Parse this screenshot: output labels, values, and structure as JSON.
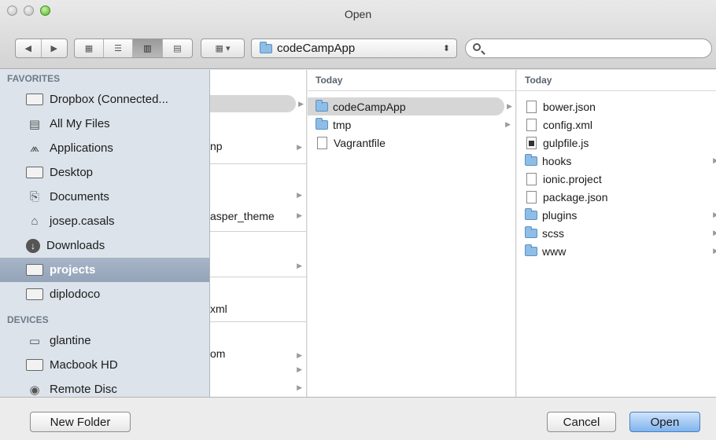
{
  "window": {
    "title": "Open"
  },
  "toolbar": {
    "view_icons": [
      "icon-view",
      "list-view",
      "column-view",
      "coverflow-view"
    ],
    "location": "codeCampApp",
    "search_placeholder": ""
  },
  "sidebar": {
    "favorites_header": "FAVORITES",
    "favorites": [
      {
        "label": "Dropbox (Connected...",
        "icon": "folder-icon"
      },
      {
        "label": "All My Files",
        "icon": "all-files-icon"
      },
      {
        "label": "Applications",
        "icon": "applications-icon"
      },
      {
        "label": "Desktop",
        "icon": "desktop-icon"
      },
      {
        "label": "Documents",
        "icon": "documents-icon"
      },
      {
        "label": "josep.casals",
        "icon": "home-icon"
      },
      {
        "label": "Downloads",
        "icon": "downloads-icon"
      },
      {
        "label": "projects",
        "icon": "folder-icon",
        "selected": true
      },
      {
        "label": "diplodoco",
        "icon": "folder-icon"
      }
    ],
    "devices_header": "DEVICES",
    "devices": [
      {
        "label": "glantine",
        "icon": "laptop-icon"
      },
      {
        "label": "Macbook HD",
        "icon": "disk-icon"
      },
      {
        "label": "Remote Disc",
        "icon": "remote-disc-icon"
      }
    ]
  },
  "column1": {
    "items": [
      "",
      "np",
      "asper_theme",
      "",
      "xml",
      "om",
      "",
      ""
    ]
  },
  "column2": {
    "header": "Today",
    "items": [
      {
        "label": "codeCampApp",
        "type": "folder",
        "selected": true,
        "has_children": true
      },
      {
        "label": "tmp",
        "type": "folder",
        "has_children": true
      },
      {
        "label": "Vagrantfile",
        "type": "file"
      }
    ]
  },
  "column3": {
    "header": "Today",
    "items": [
      {
        "label": "bower.json",
        "type": "file"
      },
      {
        "label": "config.xml",
        "type": "file"
      },
      {
        "label": "gulpfile.js",
        "type": "script"
      },
      {
        "label": "hooks",
        "type": "folder"
      },
      {
        "label": "ionic.project",
        "type": "file"
      },
      {
        "label": "package.json",
        "type": "file"
      },
      {
        "label": "plugins",
        "type": "folder"
      },
      {
        "label": "scss",
        "type": "folder"
      },
      {
        "label": "www",
        "type": "folder"
      }
    ]
  },
  "buttons": {
    "new_folder": "New Folder",
    "cancel": "Cancel",
    "open": "Open"
  }
}
